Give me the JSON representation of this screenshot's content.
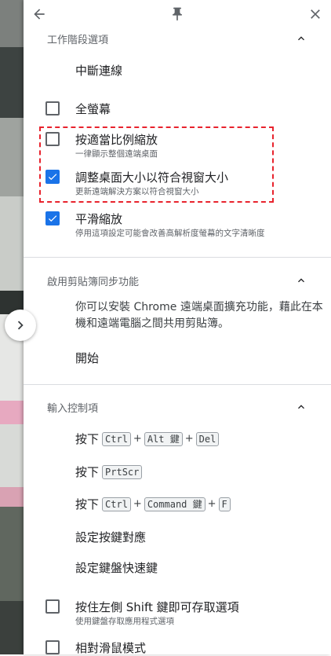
{
  "colors": {
    "accent": "#1a73e8",
    "highlight_border": "#e8232d",
    "muted": "#5f6368"
  },
  "topbar": {
    "back_icon": "arrow-back-icon",
    "pin_icon": "pin-icon",
    "close_icon": "close-icon"
  },
  "session": {
    "title": "工作階段選項",
    "disconnect_label": "中斷連線",
    "fullscreen": {
      "label": "全螢幕",
      "checked": false
    },
    "shrink_to_fit": {
      "label": "按適當比例縮放",
      "description": "一律顯示整個遠端桌面",
      "checked": false
    },
    "resize_to_fit": {
      "label": "調整桌面大小以符合視窗大小",
      "description": "更新遠端解決方案以符合視窗大小",
      "checked": true
    },
    "smooth_scaling": {
      "label": "平滑縮放",
      "description": "停用這項設定可能會改善高解析度螢幕的文字清晰度",
      "checked": true
    }
  },
  "clipboard": {
    "title": "啟用剪貼簿同步功能",
    "description": "你可以安裝 Chrome 遠端桌面擴充功能，藉此在本機和遠端電腦之間共用剪貼簿。",
    "start_label": "開始"
  },
  "input": {
    "title": "輸入控制項",
    "press_label": "按下",
    "key_ctrl": "Ctrl",
    "key_alt": "Alt 鍵",
    "key_del": "Del",
    "key_prtscr": "PrtScr",
    "key_command": "Command 鍵",
    "key_f": "F",
    "plus": "+",
    "configure_keys": "設定按鍵對應",
    "configure_shortcuts": "設定鍵盤快速鍵",
    "hold_shift": {
      "label": "按住左側 Shift 鍵即可存取選項",
      "description": "使用鍵盤存取應用程式選項",
      "checked": false
    },
    "relative_mouse": {
      "label": "相對滑鼠模式",
      "checked": false
    }
  }
}
